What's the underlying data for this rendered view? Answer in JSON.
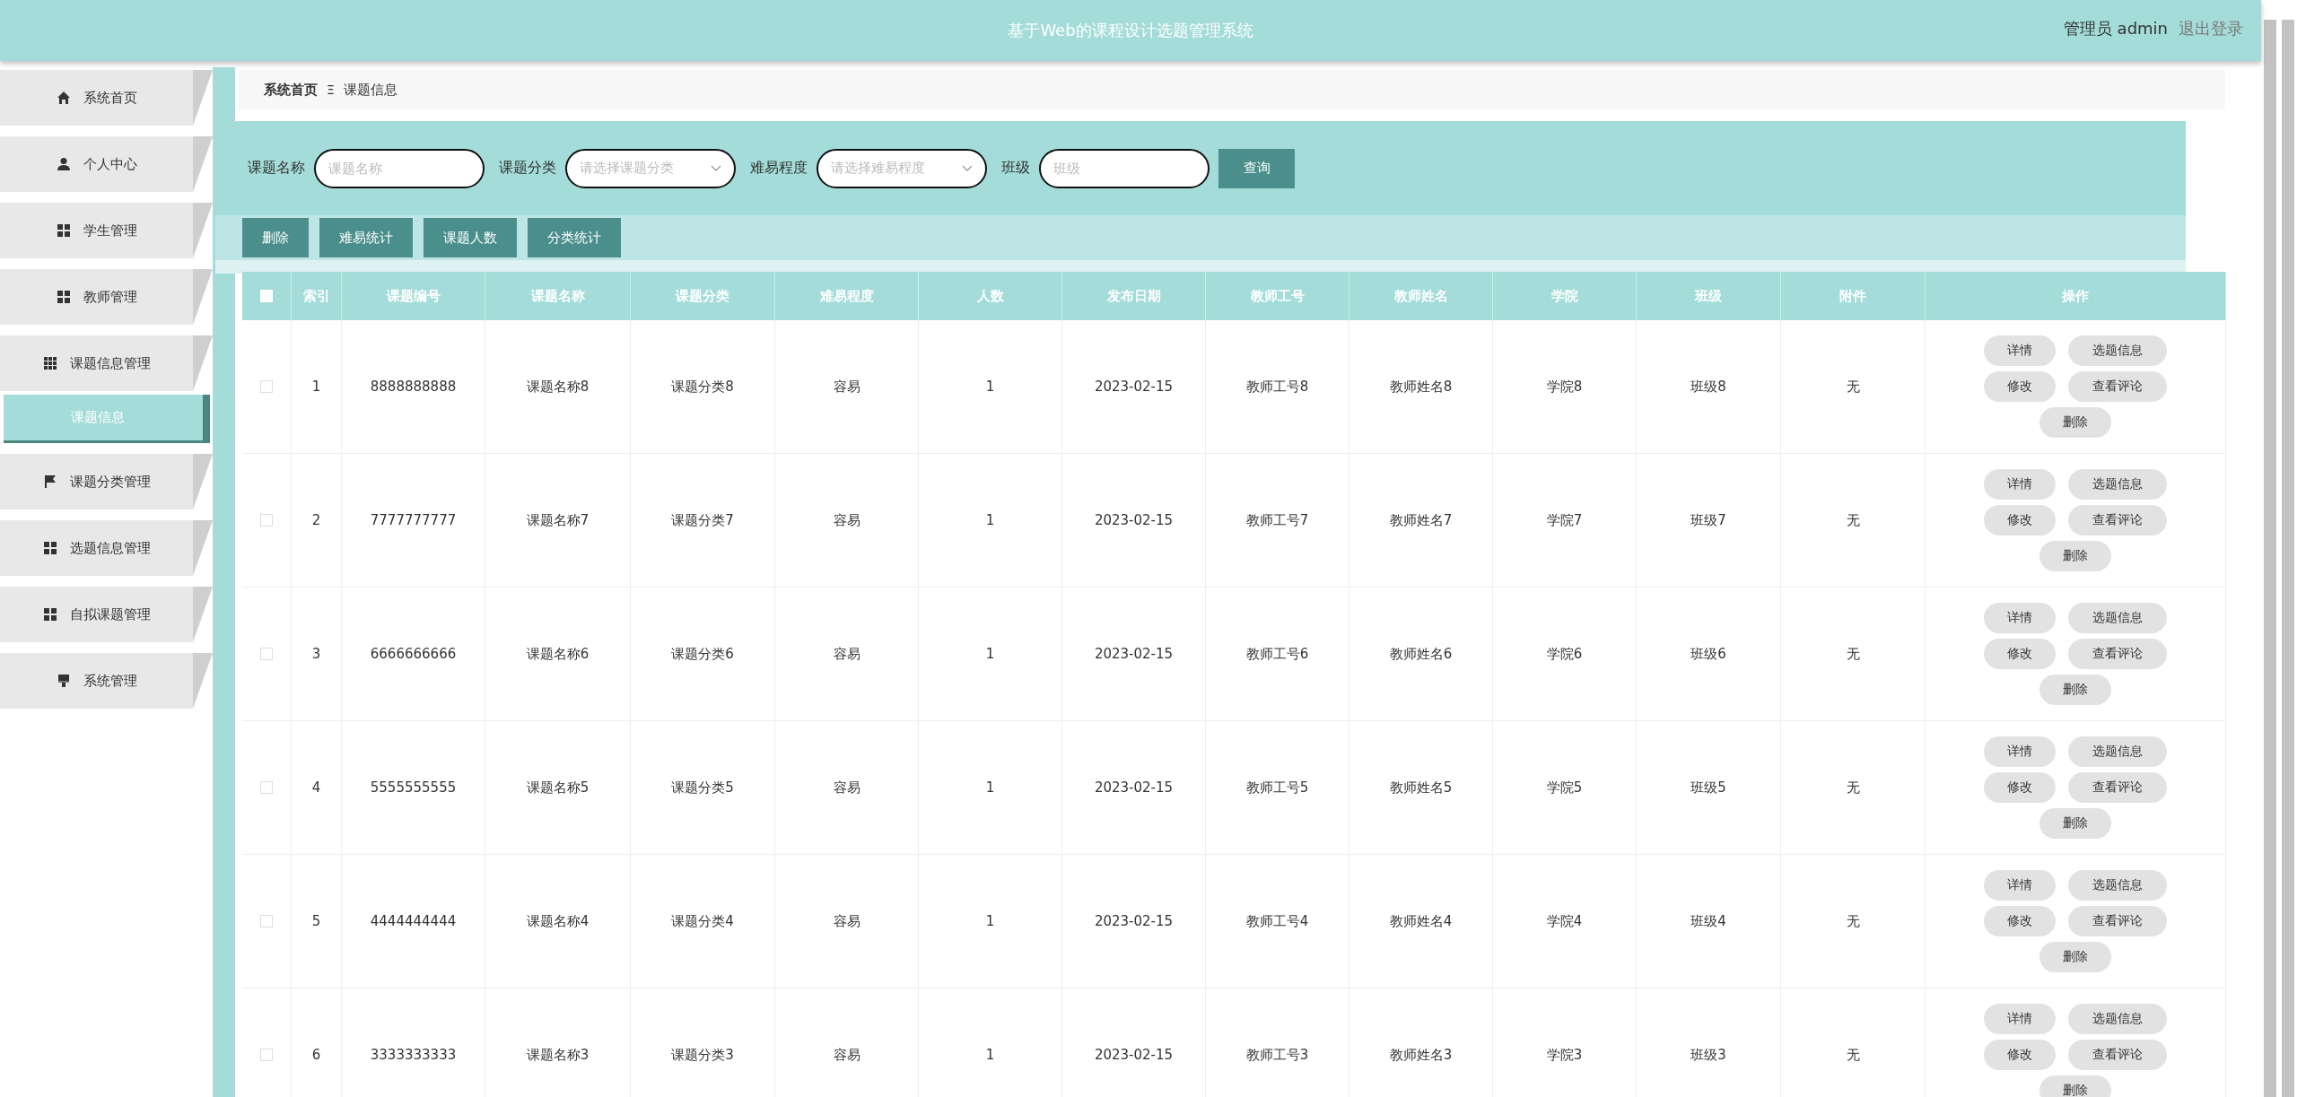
{
  "header": {
    "title": "基于Web的课程设计选题管理系统",
    "user": "管理员 admin",
    "logout": "退出登录"
  },
  "sidebar": {
    "items": [
      {
        "label": "系统首页",
        "kind": "home",
        "selected": false
      },
      {
        "label": "个人中心",
        "kind": "user",
        "selected": false
      },
      {
        "label": "学生管理",
        "kind": "grid",
        "selected": false
      },
      {
        "label": "教师管理",
        "kind": "grid",
        "selected": false
      },
      {
        "label": "课题信息管理",
        "kind": "grid9",
        "selected": false,
        "children": [
          {
            "label": "课题信息",
            "selected": true
          }
        ]
      },
      {
        "label": "课题分类管理",
        "kind": "flag",
        "selected": false
      },
      {
        "label": "选题信息管理",
        "kind": "grid",
        "selected": false
      },
      {
        "label": "自拟课题管理",
        "kind": "grid",
        "selected": false
      },
      {
        "label": "系统管理",
        "kind": "brush",
        "selected": false
      }
    ]
  },
  "breadcrumb": {
    "items": [
      "系统首页",
      "课题信息"
    ],
    "separator": "Ξ"
  },
  "search": {
    "fields": [
      {
        "label": "课题名称",
        "placeholder": "课题名称",
        "kind": "input"
      },
      {
        "label": "课题分类",
        "placeholder": "请选择课题分类",
        "kind": "select"
      },
      {
        "label": "难易程度",
        "placeholder": "请选择难易程度",
        "kind": "select"
      },
      {
        "label": "班级",
        "placeholder": "班级",
        "kind": "input"
      }
    ],
    "button": "查询"
  },
  "actions": [
    "删除",
    "难易统计",
    "课题人数",
    "分类统计"
  ],
  "table": {
    "select_all": false,
    "columns": [
      "索引",
      "课题编号",
      "课题名称",
      "课题分类",
      "难易程度",
      "人数",
      "发布日期",
      "教师工号",
      "教师姓名",
      "学院",
      "班级",
      "附件",
      "操作"
    ],
    "rows": [
      {
        "checked": false,
        "cells": [
          "1",
          "8888888888",
          "课题名称8",
          "课题分类8",
          "容易",
          "1",
          "2023-02-15",
          "教师工号8",
          "教师姓名8",
          "学院8",
          "班级8",
          "无"
        ],
        "buttons": [
          "详情",
          "选题信息",
          "修改",
          "查看评论",
          "删除"
        ]
      },
      {
        "checked": false,
        "cells": [
          "2",
          "7777777777",
          "课题名称7",
          "课题分类7",
          "容易",
          "1",
          "2023-02-15",
          "教师工号7",
          "教师姓名7",
          "学院7",
          "班级7",
          "无"
        ],
        "buttons": [
          "详情",
          "选题信息",
          "修改",
          "查看评论",
          "删除"
        ]
      },
      {
        "checked": false,
        "cells": [
          "3",
          "6666666666",
          "课题名称6",
          "课题分类6",
          "容易",
          "1",
          "2023-02-15",
          "教师工号6",
          "教师姓名6",
          "学院6",
          "班级6",
          "无"
        ],
        "buttons": [
          "详情",
          "选题信息",
          "修改",
          "查看评论",
          "删除"
        ]
      },
      {
        "checked": false,
        "cells": [
          "4",
          "5555555555",
          "课题名称5",
          "课题分类5",
          "容易",
          "1",
          "2023-02-15",
          "教师工号5",
          "教师姓名5",
          "学院5",
          "班级5",
          "无"
        ],
        "buttons": [
          "详情",
          "选题信息",
          "修改",
          "查看评论",
          "删除"
        ]
      },
      {
        "checked": false,
        "cells": [
          "5",
          "4444444444",
          "课题名称4",
          "课题分类4",
          "容易",
          "1",
          "2023-02-15",
          "教师工号4",
          "教师姓名4",
          "学院4",
          "班级4",
          "无"
        ],
        "buttons": [
          "详情",
          "选题信息",
          "修改",
          "查看评论",
          "删除"
        ]
      },
      {
        "checked": false,
        "cells": [
          "6",
          "3333333333",
          "课题名称3",
          "课题分类3",
          "容易",
          "1",
          "2023-02-15",
          "教师工号3",
          "教师姓名3",
          "学院3",
          "班级3",
          "无"
        ],
        "buttons": [
          "详情",
          "选题信息",
          "修改",
          "查看评论",
          "删除"
        ]
      }
    ]
  }
}
